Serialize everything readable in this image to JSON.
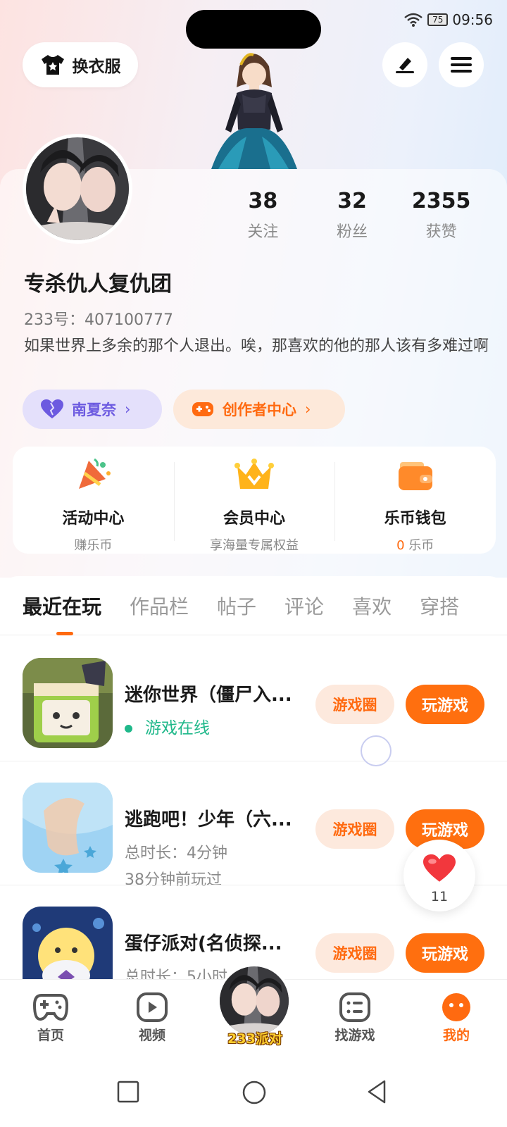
{
  "status": {
    "battery": "75",
    "time": "09:56"
  },
  "header": {
    "wardrobe_label": "换衣服"
  },
  "profile": {
    "stats": [
      {
        "value": "38",
        "label": "关注"
      },
      {
        "value": "32",
        "label": "粉丝"
      },
      {
        "value": "2355",
        "label": "获赞"
      }
    ],
    "name": "专杀仇人复仇团",
    "id_text": "233号：407100777",
    "bio": "如果世界上多余的那个人退出。唉，那喜欢的他的那人该有多难过啊",
    "tag_partner": "南夏奈",
    "tag_creator": "创作者中心"
  },
  "quick": [
    {
      "title": "活动中心",
      "sub": "赚乐币"
    },
    {
      "title": "会员中心",
      "sub": "享海量专属权益"
    },
    {
      "title": "乐币钱包",
      "sub_value": "0",
      "sub_unit": " 乐币"
    }
  ],
  "tabs": [
    "最近在玩",
    "作品栏",
    "帖子",
    "评论",
    "喜欢",
    "穿搭"
  ],
  "games": [
    {
      "title": "迷你世界（僵尸入...",
      "status": "游戏在线",
      "btn_circle": "游戏圈",
      "btn_play": "玩游戏"
    },
    {
      "title": "逃跑吧！少年（六...",
      "duration": "总时长：4分钟",
      "last": "38分钟前玩过",
      "btn_circle": "游戏圈",
      "btn_play": "玩游戏"
    },
    {
      "title": "蛋仔派对(名侦探...",
      "duration": "总时长：5小时",
      "btn_circle": "游戏圈",
      "btn_play": "玩游戏"
    }
  ],
  "like_count": "11",
  "bottom_nav": [
    {
      "label": "首页"
    },
    {
      "label": "视频"
    },
    {
      "label": "233派对"
    },
    {
      "label": "找游戏"
    },
    {
      "label": "我的"
    }
  ],
  "colors": {
    "accent": "#ff6f0f",
    "online": "#1fb88a",
    "purple": "#6c5ae0"
  }
}
